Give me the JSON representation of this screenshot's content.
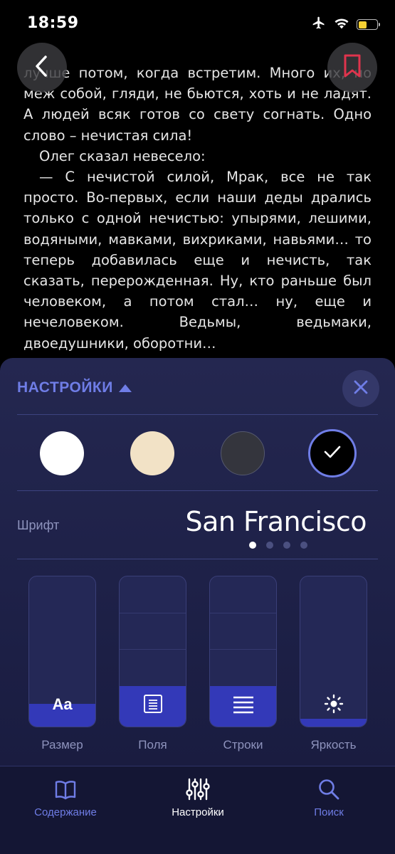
{
  "status_bar": {
    "time": "18:59"
  },
  "book": {
    "paragraphs": [
      {
        "text": "лучше потом, когда встретим. Много их, но меж собой, гляди, не бьются, хоть и не ладят. А людей всяк готов со свету согнать. Одно слово – нечистая сила!",
        "indent": false
      },
      {
        "text": "Олег сказал невесело:",
        "indent": true
      },
      {
        "text": "— С нечистой силой, Мрак, все не так просто. Во-первых, если наши деды дрались только с одной нечистью: упырями, лешими, водяными, мавками, вихриками, навьями… то теперь добавилась еще и нечисть, так сказать, перерожденная. Ну, кто раньше был человеком, а потом стал… ну, еще и нечеловеком. Ведьмы, ведьмаки, двоедушники, оборотни…",
        "indent": true
      }
    ]
  },
  "settings": {
    "title": "НАСТРОЙКИ",
    "themes": [
      {
        "name": "white",
        "color": "#ffffff",
        "selected": false
      },
      {
        "name": "sepia",
        "color": "#f2e2c6",
        "selected": false
      },
      {
        "name": "gray",
        "color": "#34353d",
        "selected": false
      },
      {
        "name": "black",
        "color": "#000000",
        "selected": true
      }
    ],
    "font": {
      "label": "Шрифт",
      "value": "San Francisco",
      "page_count": 4,
      "current_page": 1
    },
    "sliders": [
      {
        "key": "size",
        "label": "Размер",
        "glyph": "Aa",
        "level": 0.15
      },
      {
        "key": "margins",
        "label": "Поля",
        "level": 0.27
      },
      {
        "key": "lines",
        "label": "Строки",
        "level": 0.27
      },
      {
        "key": "brightness",
        "label": "Яркость",
        "level": 0.05
      }
    ]
  },
  "tabbar": {
    "tabs": [
      {
        "key": "contents",
        "label": "Содержание",
        "active": false
      },
      {
        "key": "settings",
        "label": "Настройки",
        "active": true
      },
      {
        "key": "search",
        "label": "Поиск",
        "active": false
      }
    ]
  },
  "colors": {
    "accent": "#6f7de6",
    "slider_fill": "#3339b8",
    "bookmark": "#e0344d",
    "battery": "#f5d033"
  }
}
